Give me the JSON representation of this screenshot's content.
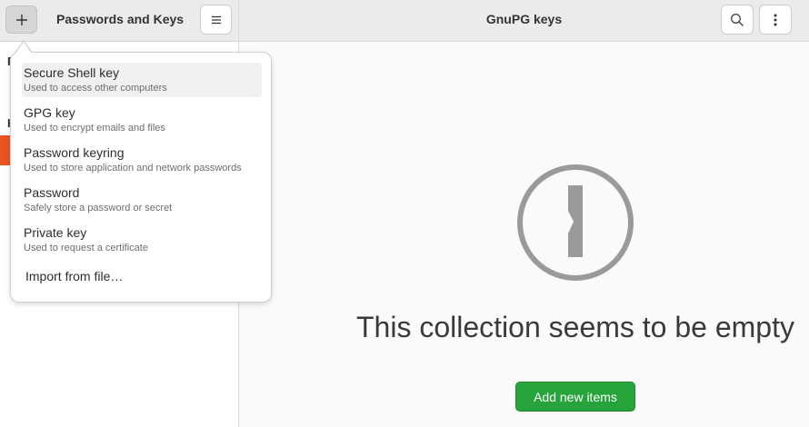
{
  "sidebar": {
    "title": "Passwords and Keys",
    "cut_label_1": "P",
    "cut_label_2": "K"
  },
  "main": {
    "title": "GnuPG keys",
    "empty_message": "This collection seems to be empty",
    "add_items_label": "Add new items"
  },
  "add_menu": {
    "items": [
      {
        "title": "Secure Shell key",
        "subtitle": "Used to access other computers"
      },
      {
        "title": "GPG key",
        "subtitle": "Used to encrypt emails and files"
      },
      {
        "title": "Password keyring",
        "subtitle": "Used to store application and network passwords"
      },
      {
        "title": "Password",
        "subtitle": "Safely store a password or secret"
      },
      {
        "title": "Private key",
        "subtitle": "Used to request a certificate"
      }
    ],
    "import_label": "Import from file…"
  },
  "icons": {
    "add": "plus-icon",
    "menu": "hamburger-icon",
    "search": "search-icon",
    "more": "vertical-ellipsis-icon",
    "empty": "keyhole-icon"
  },
  "colors": {
    "accent": "#e95420",
    "success": "#26a33a"
  }
}
